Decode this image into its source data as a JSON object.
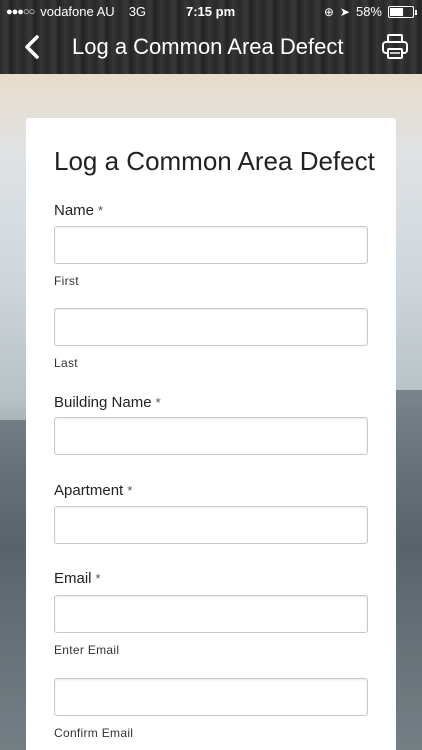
{
  "status_bar": {
    "signal_dots": "●●●○○",
    "carrier": "vodafone AU",
    "network": "3G",
    "time": "7:15 pm",
    "battery_percent": "58%",
    "battery_level": 0.58
  },
  "nav": {
    "title": "Log a Common Area Defect",
    "back_icon": "chevron-left-icon",
    "print_icon": "printer-icon"
  },
  "form": {
    "title": "Log a Common Area Defect",
    "required_mark": "*",
    "name_label": "Name",
    "first_sub": "First",
    "last_sub": "Last",
    "building_label": "Building Name",
    "apartment_label": "Apartment",
    "email_label": "Email",
    "enter_email_sub": "Enter Email",
    "confirm_email_sub": "Confirm Email"
  },
  "colors": {
    "header_bg": "#2b2b2b",
    "card_bg": "#ffffff",
    "text": "#222222"
  }
}
